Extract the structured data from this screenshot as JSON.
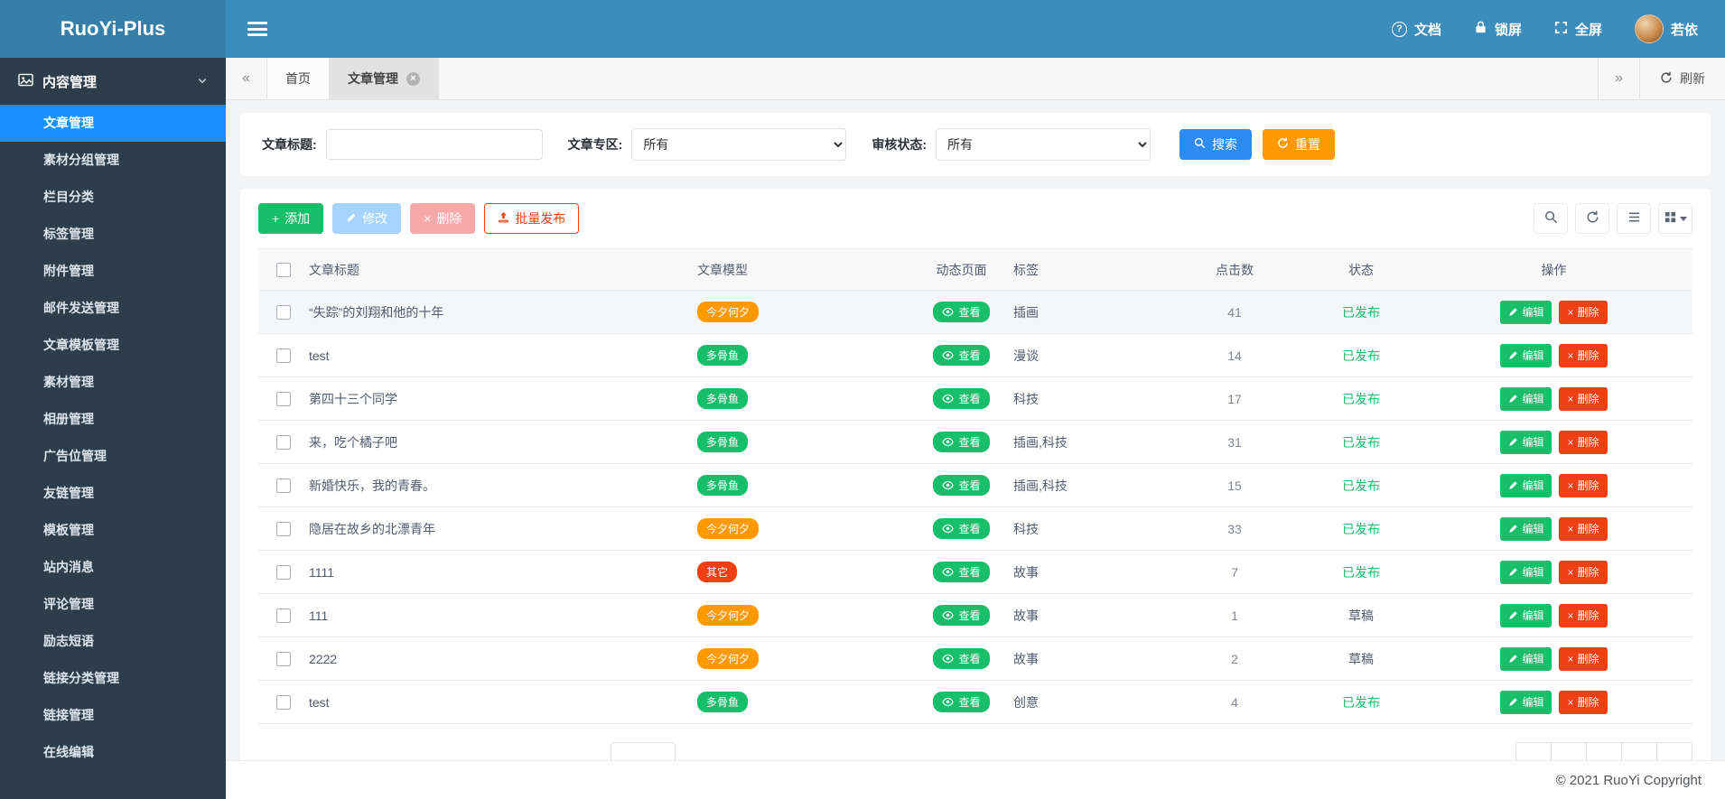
{
  "colors": {
    "orange": "#ff9900",
    "green": "#19be6b",
    "red": "#ed4014",
    "blue": "#2d8cf0",
    "dark": "#515a6e",
    "gray": "#808695"
  },
  "header": {
    "logo": "RuoYi-Plus",
    "docs": "文档",
    "lock": "锁屏",
    "fullscreen": "全屏",
    "username": "若依"
  },
  "sidebar": {
    "group": "内容管理",
    "active_item": "文章管理",
    "items": [
      "文章管理",
      "素材分组管理",
      "栏目分类",
      "标签管理",
      "附件管理",
      "邮件发送管理",
      "文章模板管理",
      "素材管理",
      "相册管理",
      "广告位管理",
      "友链管理",
      "模板管理",
      "站内消息",
      "评论管理",
      "励志短语",
      "链接分类管理",
      "链接管理",
      "在线编辑"
    ]
  },
  "tabs": {
    "items": [
      {
        "label": "首页",
        "closable": false,
        "active": false
      },
      {
        "label": "文章管理",
        "closable": true,
        "active": true
      }
    ],
    "refresh_label": "刷新"
  },
  "filters": {
    "title_label": "文章标题:",
    "zone_label": "文章专区:",
    "zone_value": "所有",
    "status_label": "审核状态:",
    "status_value": "所有",
    "search_label": "搜索",
    "reset_label": "重置"
  },
  "toolbar": {
    "add": "添加",
    "edit": "修改",
    "delete": "删除",
    "batch_publish": "批量发布"
  },
  "table": {
    "headers": [
      "文章标题",
      "文章模型",
      "动态页面",
      "标签",
      "点击数",
      "状态",
      "操作"
    ],
    "view_label": "查看",
    "row_edit_label": "编辑",
    "row_delete_label": "删除",
    "rows": [
      {
        "title": "“失踪”的刘翔和他的十年",
        "model": "今夕何夕",
        "model_color": "orange",
        "tags": "插画",
        "clicks": 41,
        "status": "已发布",
        "status_color": "green"
      },
      {
        "title": "test",
        "model": "多骨鱼",
        "model_color": "green",
        "tags": "漫谈",
        "clicks": 14,
        "status": "已发布",
        "status_color": "green"
      },
      {
        "title": "第四十三个同学",
        "model": "多骨鱼",
        "model_color": "green",
        "tags": "科技",
        "clicks": 17,
        "status": "已发布",
        "status_color": "green"
      },
      {
        "title": "来，吃个橘子吧",
        "model": "多骨鱼",
        "model_color": "green",
        "tags": "插画,科技",
        "clicks": 31,
        "status": "已发布",
        "status_color": "green"
      },
      {
        "title": "新婚快乐，我的青春。",
        "model": "多骨鱼",
        "model_color": "green",
        "tags": "插画,科技",
        "clicks": 15,
        "status": "已发布",
        "status_color": "green"
      },
      {
        "title": "隐居在故乡的北漂青年",
        "model": "今夕何夕",
        "model_color": "orange",
        "tags": "科技",
        "clicks": 33,
        "status": "已发布",
        "status_color": "green"
      },
      {
        "title": "1111",
        "model": "其它",
        "model_color": "red",
        "tags": "故事",
        "clicks": 7,
        "status": "已发布",
        "status_color": "green"
      },
      {
        "title": "111",
        "model": "今夕何夕",
        "model_color": "orange",
        "tags": "故事",
        "clicks": 1,
        "status": "草稿",
        "status_color": "dark"
      },
      {
        "title": "2222",
        "model": "今夕何夕",
        "model_color": "orange",
        "tags": "故事",
        "clicks": 2,
        "status": "草稿",
        "status_color": "dark"
      },
      {
        "title": "test",
        "model": "多骨鱼",
        "model_color": "green",
        "tags": "创意",
        "clicks": 4,
        "status": "已发布",
        "status_color": "green"
      }
    ]
  },
  "footer": {
    "copyright": "© 2021 RuoYi Copyright"
  }
}
